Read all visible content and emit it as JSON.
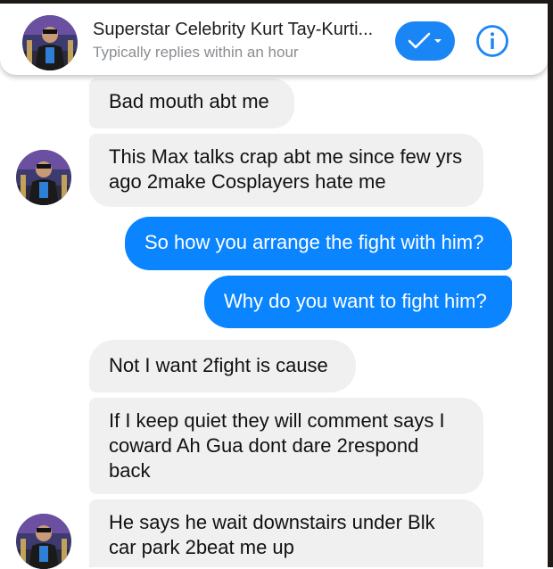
{
  "header": {
    "contact_name": "Superstar Celebrity Kurt Tay-Kurti...",
    "status": "Typically replies within an hour",
    "icons": {
      "avatar": "profile-photo",
      "check": "checkmark-dropdown-icon",
      "info": "info-icon"
    }
  },
  "colors": {
    "accent": "#0a84ff",
    "incoming_bubble": "#f0f0f0",
    "outgoing_text": "#ffffff",
    "incoming_text": "#111111"
  },
  "messages": [
    {
      "sender": "them",
      "text": "Bad mouth abt me"
    },
    {
      "sender": "them",
      "text": "This Max talks crap abt me since few yrs ago 2make Cosplayers hate me"
    },
    {
      "sender": "me",
      "text": "So how you arrange the fight with him?"
    },
    {
      "sender": "me",
      "text": "Why do you want to fight him?"
    },
    {
      "sender": "them",
      "text": "Not I want 2fight is cause"
    },
    {
      "sender": "them",
      "text": "If I keep quiet they will comment says I coward Ah Gua dont dare 2respond back"
    },
    {
      "sender": "them",
      "text": "He says he wait downstairs under Blk car park 2beat me up"
    }
  ]
}
